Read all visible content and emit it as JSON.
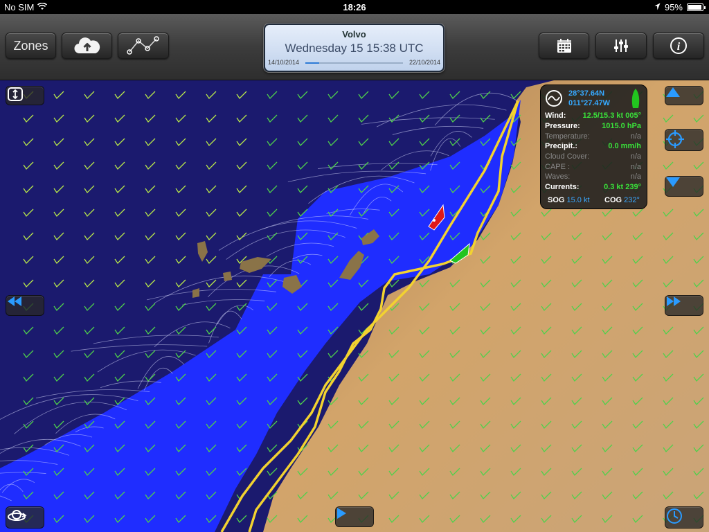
{
  "status_bar": {
    "carrier": "No SIM",
    "time": "18:26",
    "battery_text": "95%",
    "battery_level": 0.95
  },
  "toolbar": {
    "zones_label": "Zones",
    "icons": {
      "download": "cloud-upload-icon",
      "route": "route-graph-icon",
      "calendar": "calendar-icon",
      "settings": "sliders-icon",
      "info": "info-icon"
    }
  },
  "date_box": {
    "title": "Volvo",
    "current": "Wednesday 15 15:38 UTC",
    "start": "14/10/2014",
    "end": "22/10/2014",
    "progress": 0.14
  },
  "info_panel": {
    "latitude": "28°37.64N",
    "longitude": "011°27.47W",
    "rows": [
      {
        "label": "Wind:",
        "value": "12.5/15.3 kt 005°",
        "active": true
      },
      {
        "label": "Pressure:",
        "value": "1015.0 hPa",
        "active": true
      },
      {
        "label": "Temperature:",
        "value": "n/a",
        "active": false
      },
      {
        "label": "Precipit.:",
        "value": "0.0 mm/h",
        "active": true
      },
      {
        "label": "Cloud Cover:",
        "value": "n/a",
        "active": false
      },
      {
        "label": "CAPE :",
        "value": "n/a",
        "active": false
      },
      {
        "label": "Waves:",
        "value": "n/a",
        "active": false
      },
      {
        "label": "Currents:",
        "value": "0.3 kt 239°",
        "active": true
      }
    ],
    "sog_label": "SOG",
    "sog_value": "15.0 kt",
    "cog_label": "COG",
    "cog_value": "232°"
  },
  "colors": {
    "ocean": "#1b1a6e",
    "isochrones": "#1f2dff",
    "route": "#f2d230",
    "boat_red": "#e01818",
    "boat_green": "#22c41f",
    "land": "#c79a5e",
    "value_green": "#39e23a",
    "coord_blue": "#35a9ff"
  },
  "map_controls": {
    "zoom_fit": "expand-vertical-icon",
    "scroll_up": "triangle-up-icon",
    "center": "crosshair-icon",
    "scroll_down": "triangle-down-icon",
    "rewind": "rewind-icon",
    "fast_forward": "fast-forward-icon",
    "play": "play-icon",
    "rotate": "rotate-3d-icon",
    "clock": "clock-icon"
  }
}
